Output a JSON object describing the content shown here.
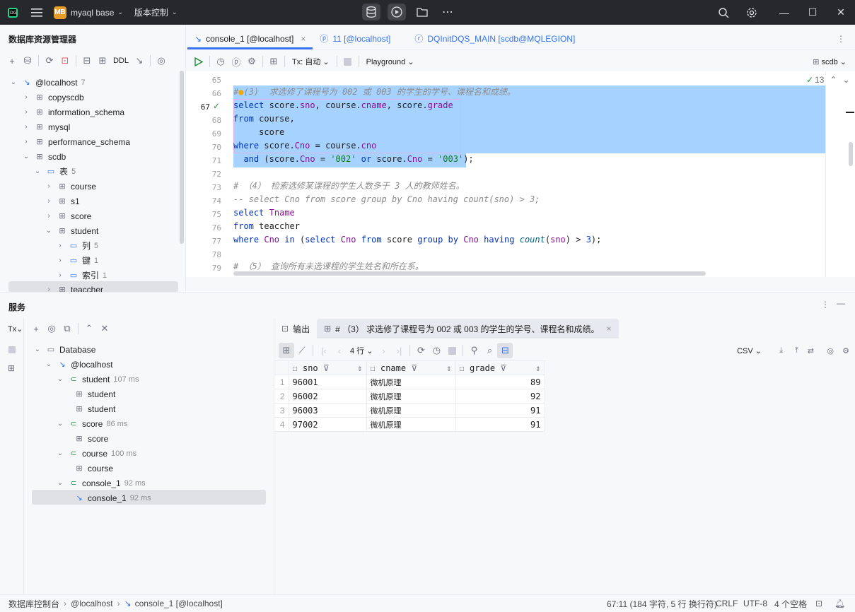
{
  "titlebar": {
    "project_badge": "MB",
    "project_name": "myaql base",
    "vcs": "版本控制"
  },
  "explorer": {
    "title": "数据库资源管理器",
    "ddl_label": "DDL",
    "tree": [
      {
        "label": "@localhost",
        "count": "7"
      },
      {
        "label": "copyscdb"
      },
      {
        "label": "information_schema"
      },
      {
        "label": "mysql"
      },
      {
        "label": "performance_schema"
      },
      {
        "label": "scdb"
      },
      {
        "label": "表",
        "count": "5"
      },
      {
        "label": "course"
      },
      {
        "label": "s1"
      },
      {
        "label": "score"
      },
      {
        "label": "student"
      },
      {
        "label": "列",
        "count": "5"
      },
      {
        "label": "键",
        "count": "1"
      },
      {
        "label": "索引",
        "count": "1"
      },
      {
        "label": "teaccher"
      }
    ]
  },
  "editor": {
    "tabs": [
      {
        "label": "console_1 [@localhost]"
      },
      {
        "label": "11 [@localhost]"
      },
      {
        "label": "DQInitDQS_MAIN [scdb@MQLEGION]"
      }
    ],
    "tx_label": "Tx: 自动",
    "playground_label": "Playground",
    "schema_label": "scdb",
    "check_count": "13",
    "line_numbers": [
      "65",
      "66",
      "67",
      "68",
      "69",
      "70",
      "71",
      "72",
      "73",
      "74",
      "75",
      "76",
      "77",
      "78",
      "79"
    ]
  },
  "services": {
    "title": "服务",
    "tx_label": "Tx",
    "tree": [
      {
        "label": "Database"
      },
      {
        "label": "@localhost"
      },
      {
        "label": "student",
        "time": "107 ms"
      },
      {
        "label": "student"
      },
      {
        "label": "student"
      },
      {
        "label": "score",
        "time": "86 ms"
      },
      {
        "label": "score"
      },
      {
        "label": "course",
        "time": "100 ms"
      },
      {
        "label": "course"
      },
      {
        "label": "console_1",
        "time": "92 ms"
      },
      {
        "label": "console_1",
        "time": "92 ms"
      }
    ],
    "tabs": {
      "output": "输出",
      "result": "# （3） 求选修了课程号为 002 或 003 的学生的学号、课程名和成绩。"
    },
    "rows_label": "4 行",
    "export_label": "CSV",
    "columns": [
      "sno",
      "cname",
      "grade"
    ],
    "rows": [
      {
        "n": "1",
        "sno": "96001",
        "cname": "微机原理",
        "grade": "89"
      },
      {
        "n": "2",
        "sno": "96002",
        "cname": "微机原理",
        "grade": "92"
      },
      {
        "n": "3",
        "sno": "96003",
        "cname": "微机原理",
        "grade": "91"
      },
      {
        "n": "4",
        "sno": "97002",
        "cname": "微机原理",
        "grade": "91"
      }
    ]
  },
  "statusbar": {
    "crumb1": "数据库控制台",
    "crumb2": "@localhost",
    "crumb3": "console_1 [@localhost]",
    "position": "67:11 (184 字符, 5 行 换行符)",
    "line_sep": "CRLF",
    "encoding": "UTF-8",
    "indent": "4 个空格"
  },
  "colors": {
    "accent": "#3574f0",
    "selection": "#a6d2ff",
    "titlebar": "#27282c"
  }
}
